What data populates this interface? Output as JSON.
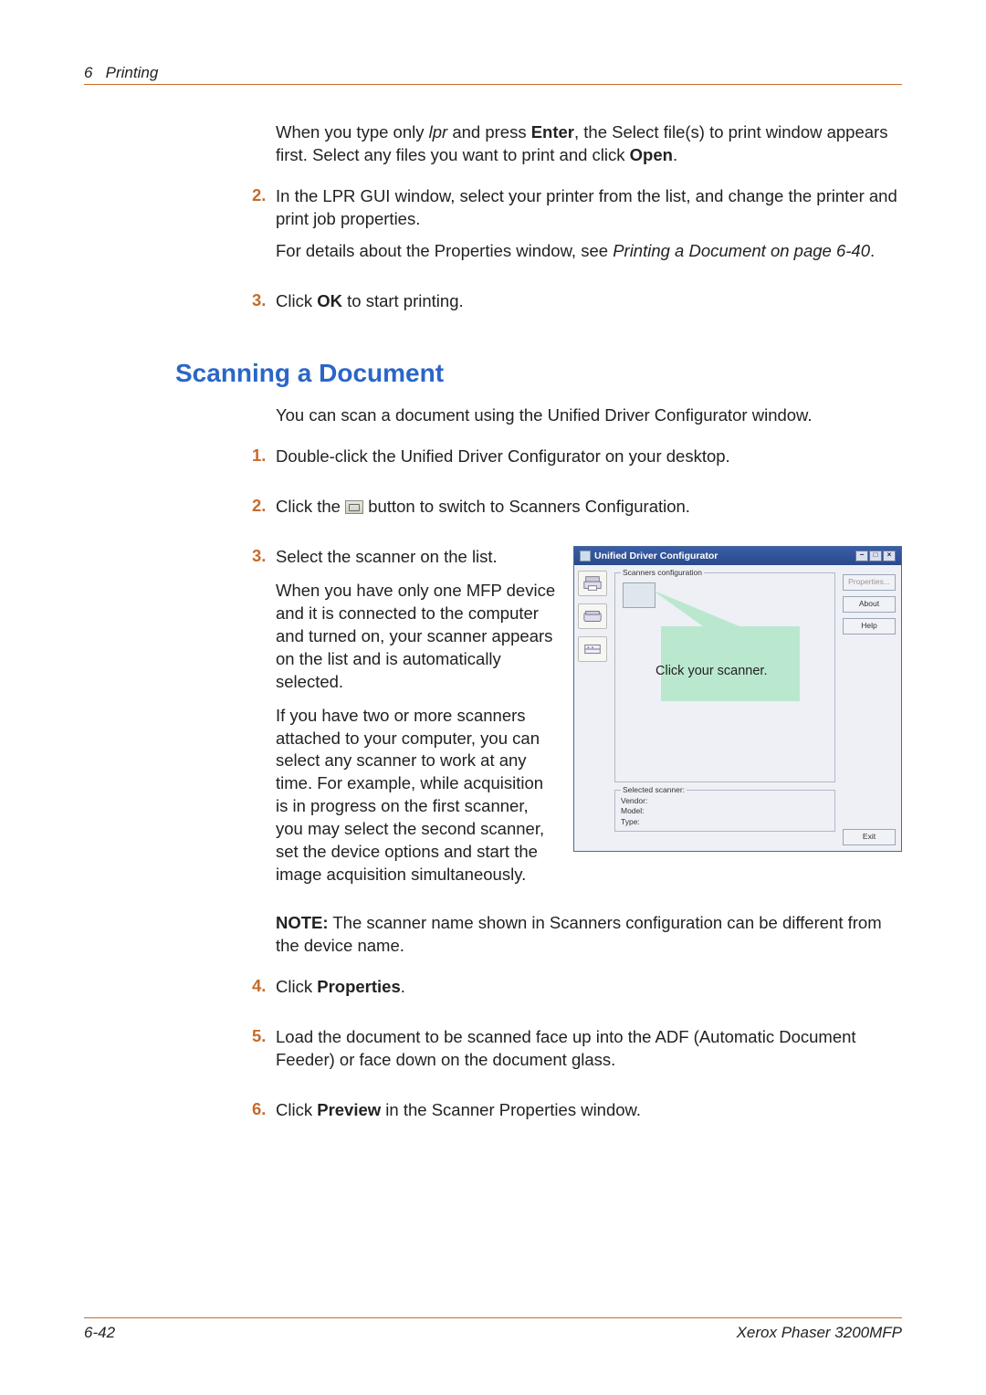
{
  "header": {
    "chapter_num": "6",
    "chapter_title": "Printing"
  },
  "intro": {
    "p1_pre": "When you type only ",
    "p1_em": "lpr",
    "p1_mid": " and press ",
    "p1_b1": "Enter",
    "p1_mid2": ", the Select file(s) to print window appears first.  Select any files you want to print and click ",
    "p1_b2": "Open",
    "p1_end": "."
  },
  "cont_steps": {
    "s2_num": "2.",
    "s2_p1": "In the LPR GUI window, select your printer from the list, and change the printer and print job properties.",
    "s2_p2_pre": "For details about the Properties window, see ",
    "s2_p2_em": "Printing a Document on page  6-40",
    "s2_p2_end": ".",
    "s3_num": "3.",
    "s3_pre": "Click ",
    "s3_b": "OK",
    "s3_end": " to start printing."
  },
  "section_title": "Scanning a Document",
  "scan": {
    "intro": "You can scan a document using the Unified Driver Configurator window.",
    "s1_num": "1.",
    "s1": "Double-click the Unified Driver Configurator on your desktop.",
    "s2_num": "2.",
    "s2_pre": "Click the ",
    "s2_post": " button to switch to Scanners Configuration.",
    "s3_num": "3.",
    "s3_p1": "Select the scanner on the list.",
    "s3_p2": "When you have only one MFP device and it is connected to the computer and turned on, your scanner appears on the list and is automatically selected.",
    "s3_p3": "If you have two or more scanners attached to your computer, you can select any scanner to work at any time. For example, while acquisition is in progress on the first scanner, you may select the second scanner, set the device options and start the image acquisition simultaneously.",
    "note_label": "NOTE:",
    "note_body": " The scanner name shown in Scanners configuration can be different from the device name.",
    "s4_num": "4.",
    "s4_pre": "Click ",
    "s4_b": "Properties",
    "s4_end": ".",
    "s5_num": "5.",
    "s5": "Load the document to be scanned face up into the ADF (Automatic Document Feeder) or face down on the document glass.",
    "s6_num": "6.",
    "s6_pre": "Click ",
    "s6_b": "Preview",
    "s6_end": " in the Scanner Properties window."
  },
  "window": {
    "title": "Unified Driver Configurator",
    "group1": "Scanners configuration",
    "callout": "Click your scanner.",
    "group2": "Selected scanner:",
    "vendor": "Vendor:",
    "model": "Model:",
    "type": "Type:",
    "btn_properties": "Properties...",
    "btn_about": "About",
    "btn_help": "Help",
    "btn_exit": "Exit"
  },
  "footer": {
    "page": "6-42",
    "product": "Xerox Phaser 3200MFP"
  }
}
